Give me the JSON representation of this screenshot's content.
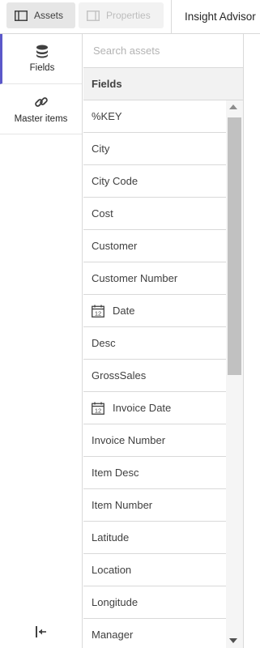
{
  "toolbar": {
    "assets_label": "Assets",
    "properties_label": "Properties",
    "insight_label": "Insight Advisor"
  },
  "sidebar": {
    "items": [
      {
        "label": "Fields",
        "icon": "database-icon",
        "active": true
      },
      {
        "label": "Master items",
        "icon": "link-icon",
        "active": false
      }
    ],
    "collapse_icon": "collapse-left-icon"
  },
  "search": {
    "placeholder": "Search assets",
    "value": ""
  },
  "fields": {
    "header": "Fields",
    "items": [
      {
        "label": "%KEY",
        "date": false
      },
      {
        "label": "City",
        "date": false
      },
      {
        "label": "City Code",
        "date": false
      },
      {
        "label": "Cost",
        "date": false
      },
      {
        "label": "Customer",
        "date": false
      },
      {
        "label": "Customer Number",
        "date": false
      },
      {
        "label": "Date",
        "date": true
      },
      {
        "label": "Desc",
        "date": false
      },
      {
        "label": "GrossSales",
        "date": false
      },
      {
        "label": "Invoice Date",
        "date": true
      },
      {
        "label": "Invoice Number",
        "date": false
      },
      {
        "label": "Item Desc",
        "date": false
      },
      {
        "label": "Item Number",
        "date": false
      },
      {
        "label": "Latitude",
        "date": false
      },
      {
        "label": "Location",
        "date": false
      },
      {
        "label": "Longitude",
        "date": false
      },
      {
        "label": "Manager",
        "date": false
      }
    ],
    "calendar_icon_text": "12"
  },
  "colors": {
    "accent": "#5b58c9",
    "scroll_thumb": "#c1c1c1"
  }
}
